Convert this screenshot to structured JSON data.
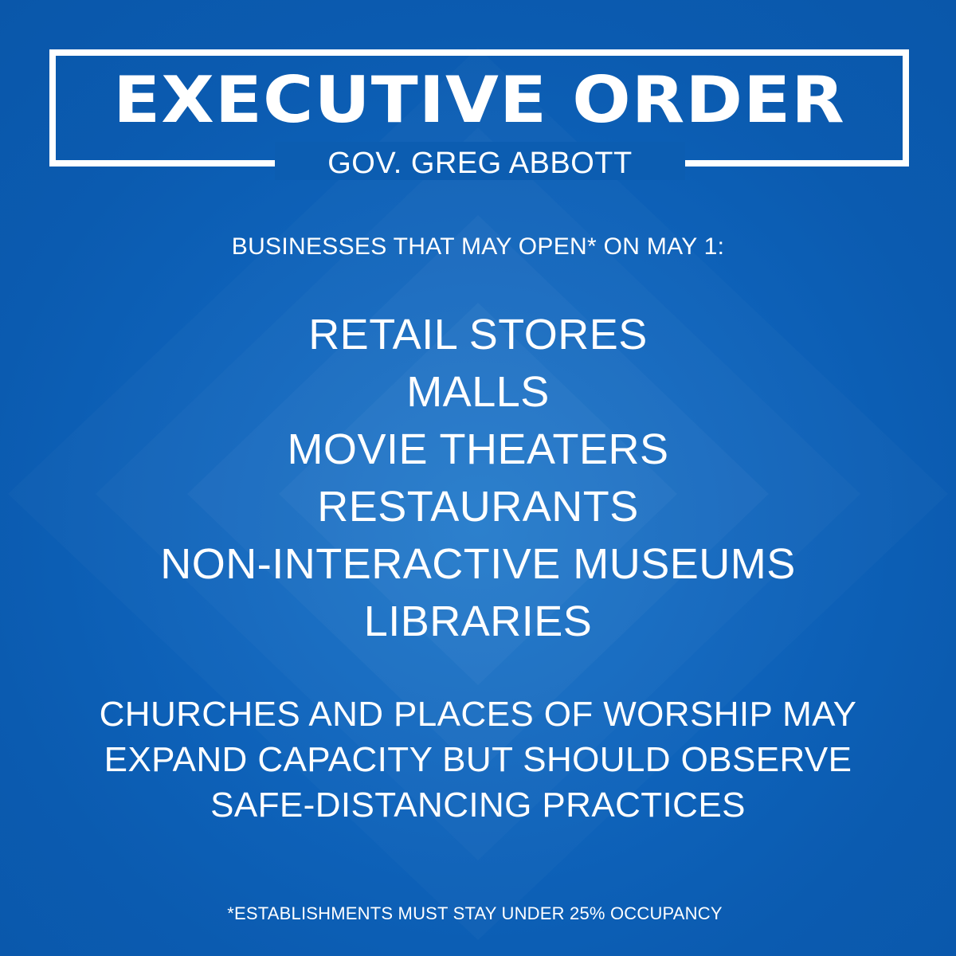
{
  "header": {
    "title": "EXECUTIVE ORDER",
    "subtitle": "GOV. GREG ABBOTT"
  },
  "intro": "BUSINESSES THAT MAY OPEN* ON MAY 1:",
  "businesses": [
    "RETAIL STORES",
    "MALLS",
    "MOVIE THEATERS",
    "RESTAURANTS",
    "NON-INTERACTIVE MUSEUMS",
    "LIBRARIES"
  ],
  "worship_note": [
    "CHURCHES AND PLACES OF WORSHIP MAY",
    "EXPAND CAPACITY BUT SHOULD OBSERVE",
    "SAFE-DISTANCING PRACTICES"
  ],
  "footnote": "*ESTABLISHMENTS MUST STAY UNDER 25% OCCUPANCY",
  "colors": {
    "background": "#0c5db1",
    "text": "#ffffff"
  }
}
